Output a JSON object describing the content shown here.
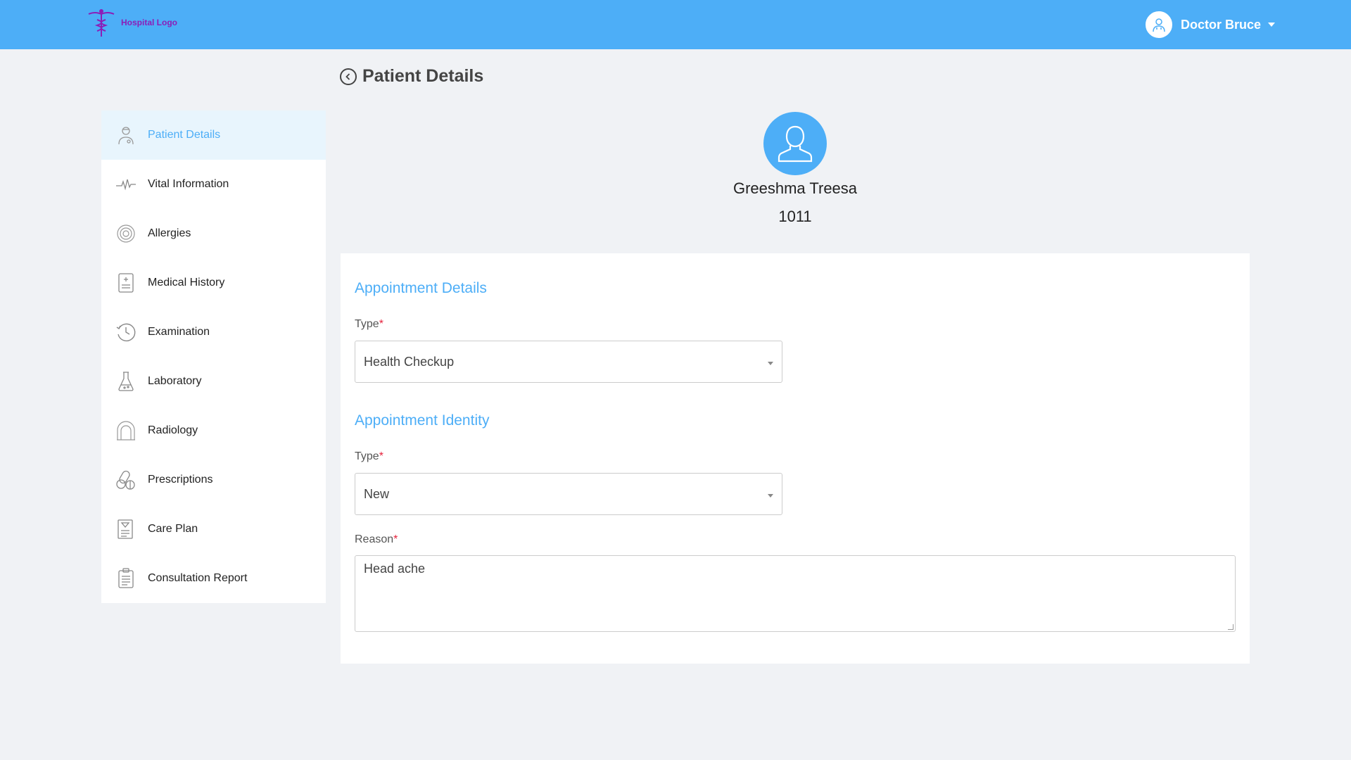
{
  "header": {
    "logo_text": "Hospital Logo",
    "user_name": "Doctor Bruce",
    "brand_color": "#4daef7",
    "logo_color": "#8b1fb8"
  },
  "page": {
    "title": "Patient Details"
  },
  "sidebar": {
    "items": [
      {
        "label": "Patient Details",
        "icon": "doctor-icon",
        "active": true
      },
      {
        "label": "Vital Information",
        "icon": "pulse-icon"
      },
      {
        "label": "Allergies",
        "icon": "fingerprint-icon"
      },
      {
        "label": "Medical History",
        "icon": "document-icon"
      },
      {
        "label": "Examination",
        "icon": "clock-history-icon"
      },
      {
        "label": "Laboratory",
        "icon": "flask-icon"
      },
      {
        "label": "Radiology",
        "icon": "radiology-icon"
      },
      {
        "label": "Prescriptions",
        "icon": "pills-icon"
      },
      {
        "label": "Care Plan",
        "icon": "care-plan-icon"
      },
      {
        "label": "Consultation Report",
        "icon": "clipboard-icon"
      }
    ]
  },
  "patient": {
    "name": "Greeshma Treesa",
    "id": "1011"
  },
  "form": {
    "appointment_details_title": "Appointment Details",
    "type_label": "Type",
    "type_value": "Health Checkup",
    "appointment_identity_title": "Appointment Identity",
    "identity_type_label": "Type",
    "identity_type_value": "New",
    "reason_label": "Reason",
    "reason_value": "Head ache",
    "required_mark": "*",
    "required_color": "#e5233d"
  }
}
